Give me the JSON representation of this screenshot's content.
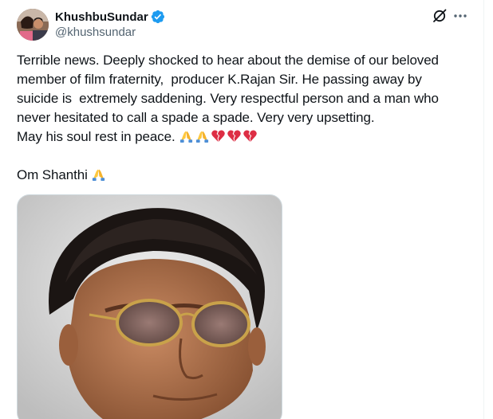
{
  "user": {
    "display_name": "KhushbuSundar",
    "handle": "@khushsundar",
    "verified": true,
    "verified_color": "#1d9bf0"
  },
  "actions": {
    "grok_icon": "grok-icon",
    "more_icon": "more-dots-icon"
  },
  "post": {
    "lines": [
      "Terrible news. Deeply shocked to hear about the demise of our beloved",
      "member of film fraternity,  producer K.Rajan Sir. He passing away by",
      "suicide is  extremely saddening. Very respectful person and a man who",
      "never hesitated to call a spade a spade. Very very upsetting.",
      "May his soul rest in peace."
    ],
    "closing": "Om Shanthi",
    "emojis_line5": [
      "folded-hands",
      "folded-hands",
      "broken-heart",
      "broken-heart",
      "broken-heart"
    ],
    "emojis_closing": [
      "folded-hands"
    ]
  },
  "media": {
    "type": "photo",
    "subject": "portrait-photo"
  }
}
